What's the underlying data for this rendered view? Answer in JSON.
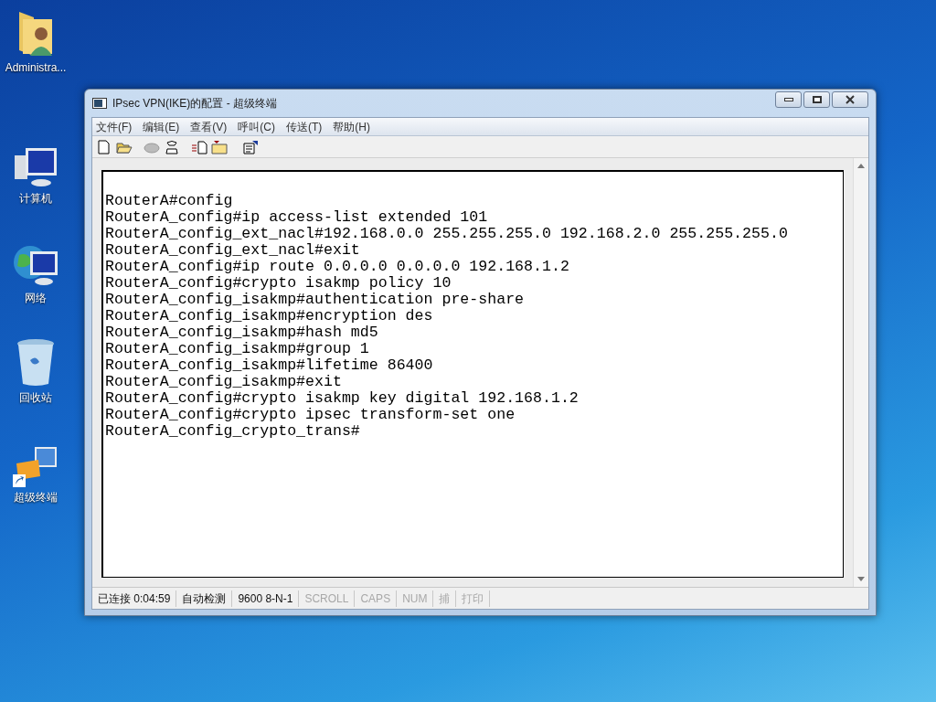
{
  "desktop_icons": [
    {
      "label": "Administra...",
      "kind": "user-folder"
    },
    {
      "label": "计算机",
      "kind": "computer"
    },
    {
      "label": "网络",
      "kind": "network"
    },
    {
      "label": "回收站",
      "kind": "recycle-bin"
    },
    {
      "label": "超级终端",
      "kind": "hyperterminal"
    }
  ],
  "window": {
    "title": "IPsec VPN(IKE)的配置 - 超级终端",
    "menu": [
      "文件(F)",
      "编辑(E)",
      "查看(V)",
      "呼叫(C)",
      "传送(T)",
      "帮助(H)"
    ],
    "terminal_lines": [
      "RouterA#config",
      "RouterA_config#ip access-list extended 101",
      "RouterA_config_ext_nacl#192.168.0.0 255.255.255.0 192.168.2.0 255.255.255.0",
      "RouterA_config_ext_nacl#exit",
      "RouterA_config#ip route 0.0.0.0 0.0.0.0 192.168.1.2",
      "RouterA_config#crypto isakmp policy 10",
      "RouterA_config_isakmp#authentication pre-share",
      "RouterA_config_isakmp#encryption des",
      "RouterA_config_isakmp#hash md5",
      "RouterA_config_isakmp#group 1",
      "RouterA_config_isakmp#lifetime 86400",
      "RouterA_config_isakmp#exit",
      "RouterA_config#crypto isakmp key digital 192.168.1.2",
      "RouterA_config#crypto ipsec transform-set one",
      "RouterA_config_crypto_trans#"
    ],
    "status_bar": [
      {
        "text": "已连接 0:04:59",
        "disabled": false
      },
      {
        "text": "自动检测",
        "disabled": false
      },
      {
        "text": "9600 8-N-1",
        "disabled": false
      },
      {
        "text": "SCROLL",
        "disabled": true
      },
      {
        "text": "CAPS",
        "disabled": true
      },
      {
        "text": "NUM",
        "disabled": true
      },
      {
        "text": "捕",
        "disabled": true
      },
      {
        "text": "打印",
        "disabled": true
      }
    ]
  }
}
